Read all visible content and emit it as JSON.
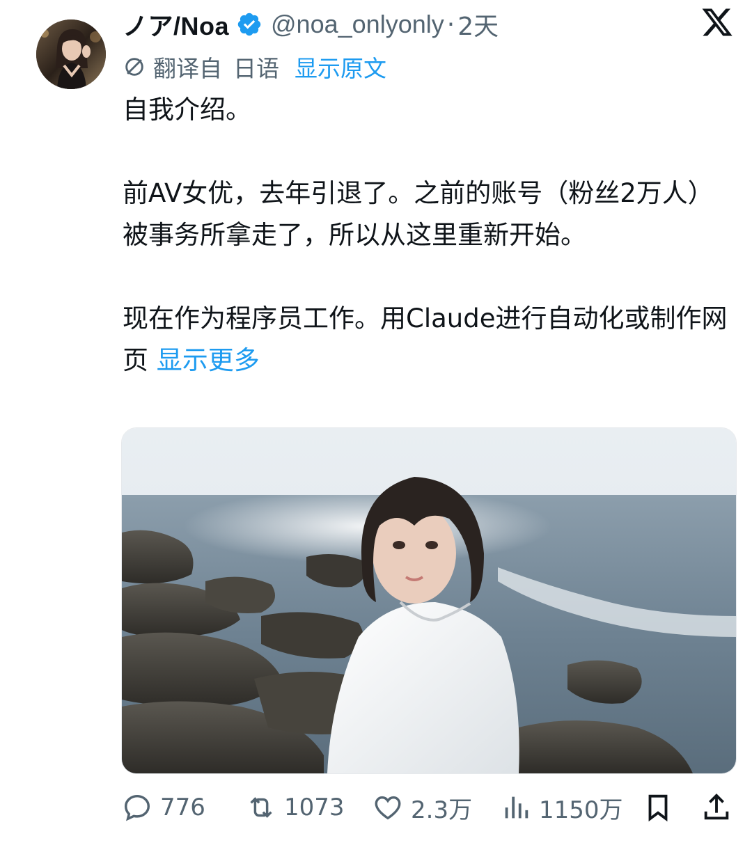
{
  "author": {
    "name": "ノア/Noa",
    "handle": "@noa_onlyonly",
    "separator": "·",
    "time": "2天",
    "verified": true
  },
  "translation": {
    "label": "翻译自",
    "language": "日语",
    "show_original": "显示原文"
  },
  "body": {
    "para1": "自我介绍。",
    "para2": "前AV女优，去年引退了。之前的账号（粉丝2万人）被事务所拿走了，所以从这里重新开始。",
    "para3": "现在作为程序员工作。用Claude进行自动化或制作网页",
    "show_more": "显示更多"
  },
  "actions": {
    "replies": "776",
    "retweets": "1073",
    "likes": "2.3万",
    "views": "1150万"
  },
  "colors": {
    "accent": "#1d9bf0",
    "secondary_text": "#536471",
    "primary_text": "#0f1419"
  },
  "icons": {
    "verified": "verified-badge-icon",
    "platform": "x-logo-icon",
    "translate": "translate-icon",
    "reply": "reply-icon",
    "retweet": "retweet-icon",
    "like": "heart-icon",
    "views": "views-icon",
    "bookmark": "bookmark-icon",
    "share": "share-icon"
  }
}
